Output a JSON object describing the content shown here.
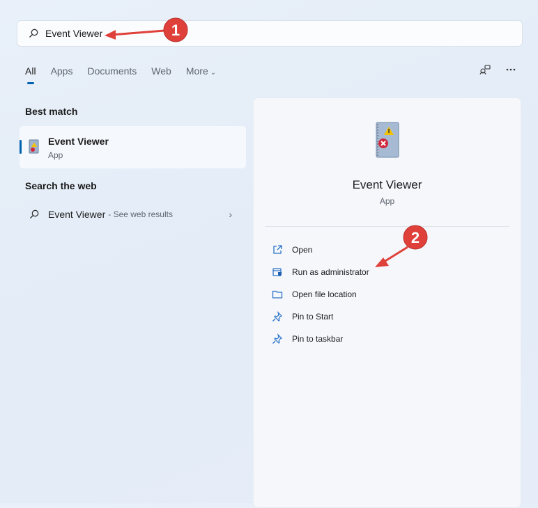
{
  "search": {
    "value": "Event Viewer"
  },
  "tabs": [
    {
      "label": "All"
    },
    {
      "label": "Apps"
    },
    {
      "label": "Documents"
    },
    {
      "label": "Web"
    },
    {
      "label": "More"
    }
  ],
  "best_match": {
    "heading": "Best match",
    "title": "Event Viewer",
    "subtitle": "App"
  },
  "web": {
    "heading": "Search the web",
    "title": "Event Viewer",
    "suffix": "- See web results"
  },
  "panel": {
    "title": "Event Viewer",
    "subtitle": "App",
    "actions": [
      {
        "label": "Open"
      },
      {
        "label": "Run as administrator"
      },
      {
        "label": "Open file location"
      },
      {
        "label": "Pin to Start"
      },
      {
        "label": "Pin to taskbar"
      }
    ]
  },
  "annotations": [
    {
      "label": "1"
    },
    {
      "label": "2"
    }
  ],
  "colors": {
    "accent": "#0063b1",
    "annotation": "#e0403a"
  }
}
